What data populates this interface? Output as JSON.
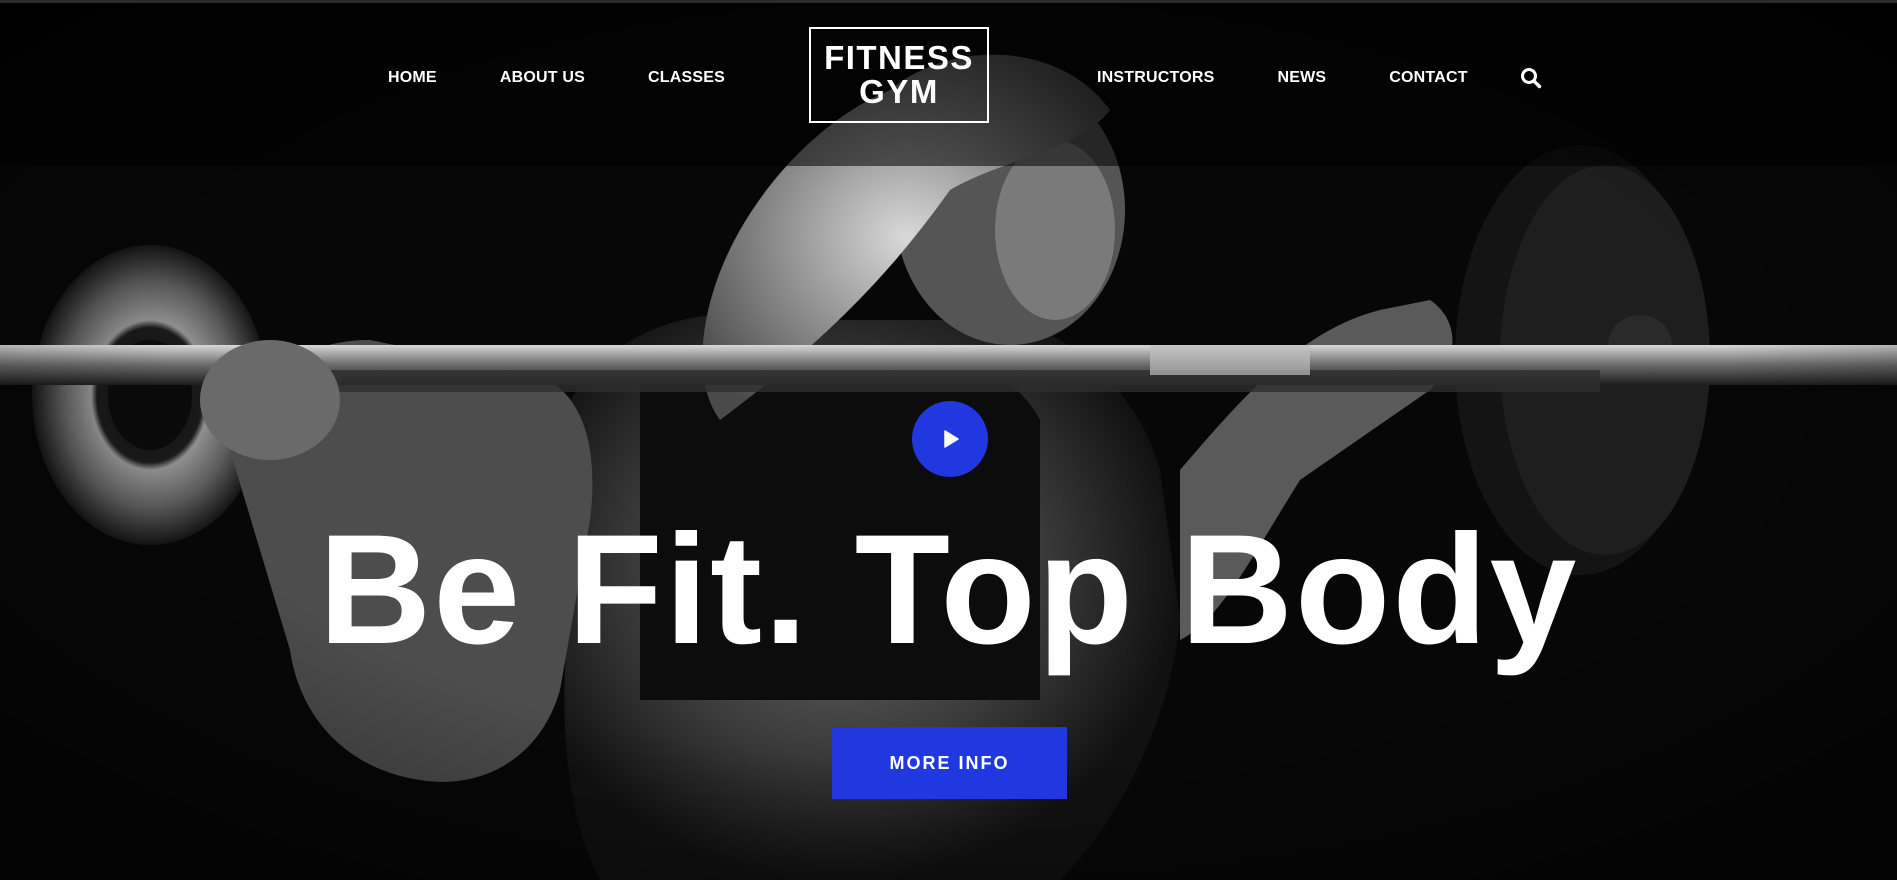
{
  "header": {
    "logo": {
      "line1": "FITNESS",
      "line2": "GYM"
    },
    "nav_left": [
      {
        "label": "HOME"
      },
      {
        "label": "ABOUT US"
      },
      {
        "label": "CLASSES"
      }
    ],
    "nav_right": [
      {
        "label": "INSTRUCTORS"
      },
      {
        "label": "NEWS"
      },
      {
        "label": "CONTACT"
      }
    ],
    "search_icon": "search-icon"
  },
  "hero": {
    "headline": "Be Fit. Top Body",
    "cta_label": "MORE INFO",
    "play_icon": "play-icon",
    "background": "barbell-athlete-photo"
  },
  "colors": {
    "accent": "#2138e0",
    "text": "#ffffff",
    "background": "#050505"
  }
}
